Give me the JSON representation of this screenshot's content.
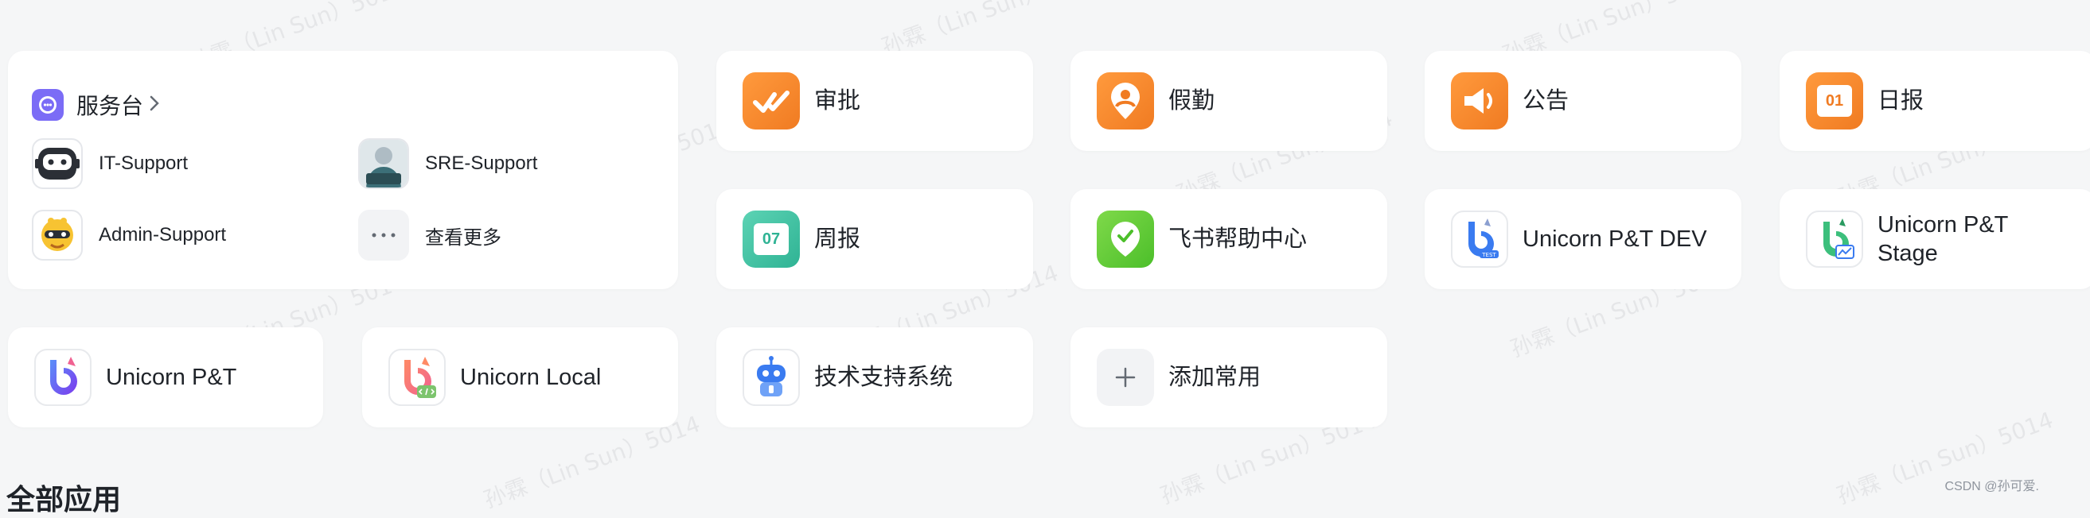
{
  "watermark": "孙霖（Lin Sun）5014",
  "service_desk": {
    "title": "服务台",
    "items": [
      {
        "label": "IT-Support"
      },
      {
        "label": "SRE-Support"
      },
      {
        "label": "Admin-Support"
      },
      {
        "label": "查看更多"
      }
    ]
  },
  "apps": [
    {
      "label": "审批",
      "icon": "approval-icon"
    },
    {
      "label": "假勤",
      "icon": "attendance-icon"
    },
    {
      "label": "公告",
      "icon": "announcement-icon"
    },
    {
      "label": "日报",
      "icon": "daily-report-icon",
      "badge": "01"
    },
    {
      "label": "周报",
      "icon": "weekly-report-icon",
      "badge": "07"
    },
    {
      "label": "飞书帮助中心",
      "icon": "help-center-icon"
    },
    {
      "label": "Unicorn P&T DEV",
      "icon": "unicorn-dev-icon",
      "badge": "TEST"
    },
    {
      "label": "Unicorn P&T Stage",
      "icon": "unicorn-stage-icon"
    },
    {
      "label": "Unicorn P&T",
      "icon": "unicorn-icon"
    },
    {
      "label": "Unicorn Local",
      "icon": "unicorn-local-icon"
    },
    {
      "label": "技术支持系统",
      "icon": "tech-support-icon"
    },
    {
      "label": "添加常用",
      "icon": "plus-icon"
    }
  ],
  "section_title": "全部应用",
  "footer_credit": "CSDN @孙可爱."
}
